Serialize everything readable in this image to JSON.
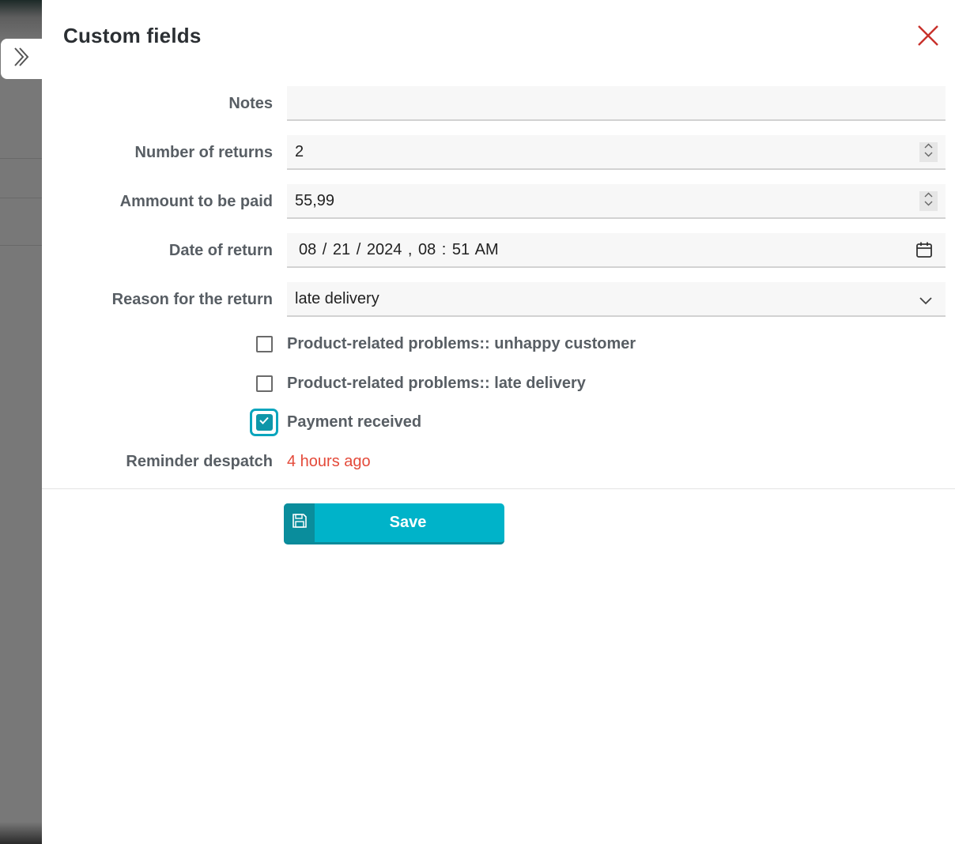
{
  "panel": {
    "title": "Custom fields"
  },
  "fields": {
    "notes": {
      "label": "Notes",
      "value": ""
    },
    "returns": {
      "label": "Number of returns",
      "value": "2"
    },
    "amount": {
      "label": "Ammount to be paid",
      "value": "55,99"
    },
    "date": {
      "label": "Date of return",
      "value": "08 / 21 / 2024 ,  08 : 51   AM"
    },
    "reason": {
      "label": "Reason for the return",
      "value": "late delivery"
    }
  },
  "checkboxes": [
    {
      "label": "Product-related problems:: unhappy customer",
      "checked": false
    },
    {
      "label": "Product-related problems:: late delivery",
      "checked": false
    },
    {
      "label": "Payment received",
      "checked": true
    }
  ],
  "reminder": {
    "label": "Reminder despatch",
    "value": "4 hours ago"
  },
  "actions": {
    "save_label": "Save"
  },
  "icons": {
    "toggle": "chevron-right-icon",
    "close": "close-icon",
    "calendar": "calendar-icon",
    "dropdown": "chevron-down-icon",
    "save": "floppy-disk-icon"
  },
  "colors": {
    "accent": "#00b3c9",
    "accent_dark": "#0a8d9c",
    "close": "#c8312b",
    "reminder": "#e44a3a"
  }
}
